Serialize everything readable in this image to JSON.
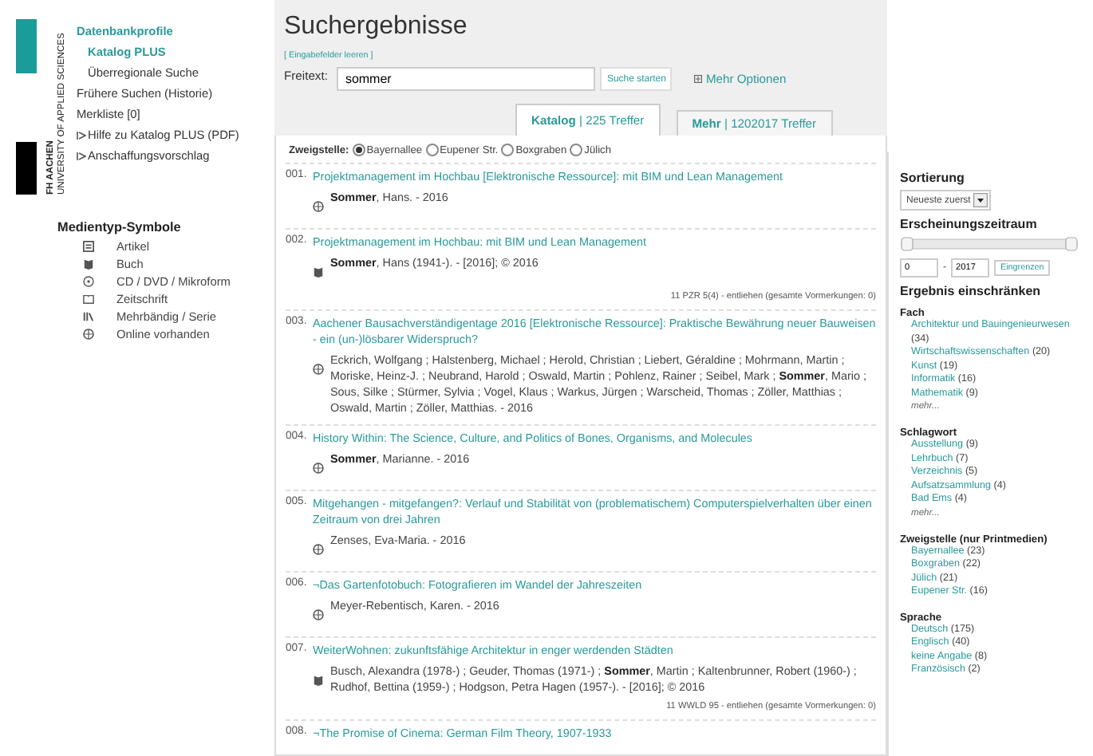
{
  "logo": {
    "line_1": "FH AACHEN",
    "line_2": "UNIVERSITY OF APPLIED SCIENCES"
  },
  "nav": [
    {
      "label": "Datenbankprofile",
      "kind": "heading"
    },
    {
      "label": "Katalog PLUS",
      "kind": "sub",
      "selected": true
    },
    {
      "label": "Überregionale Suche",
      "kind": "sub",
      "selected": false
    },
    {
      "label": "Frühere Suchen (Historie)",
      "kind": "link"
    },
    {
      "label": "Merkliste [0]",
      "kind": "link"
    },
    {
      "label": "Hilfe zu Katalog PLUS (PDF)",
      "kind": "external"
    },
    {
      "label": "Anschaffungsvorschlag",
      "kind": "external"
    }
  ],
  "media_legend": {
    "title": "Medientyp-Symbole",
    "items": [
      {
        "kind": "article",
        "label": "Artikel"
      },
      {
        "kind": "book",
        "label": "Buch"
      },
      {
        "kind": "disc",
        "label": "CD / DVD / Mikroform"
      },
      {
        "kind": "journal",
        "label": "Zeitschrift"
      },
      {
        "kind": "series",
        "label": "Mehrbändig / Serie"
      },
      {
        "kind": "online",
        "label": "Online vorhanden"
      }
    ]
  },
  "page_title": "Suchergebnisse",
  "clear_link": "[ Eingabefelder leeren ]",
  "search": {
    "label": "Freitext:",
    "value": "sommer",
    "button": "Suche starten",
    "more": "Mehr Optionen"
  },
  "tabs": [
    {
      "label": "Katalog",
      "separator": "|",
      "count": "225 Treffer",
      "selected": true
    },
    {
      "label": "Mehr",
      "separator": "|",
      "count": "1202017 Treffer",
      "selected": false
    }
  ],
  "branch_filter": {
    "label": "Zweigstelle:",
    "options": [
      {
        "label": "Bayernallee",
        "selected": true
      },
      {
        "label": "Eupener Str.",
        "selected": false
      },
      {
        "label": "Boxgraben",
        "selected": false
      },
      {
        "label": "Jülich",
        "selected": false
      }
    ]
  },
  "results": [
    {
      "number": "001.",
      "title": "Projektmanagement im Hochbau [Elektronische Ressource]: mit BIM und Lean Management",
      "kind": "online",
      "authors": "**Sommer**, Hans. - 2016"
    },
    {
      "number": "002.",
      "title": "Projektmanagement im Hochbau: mit BIM und Lean Management",
      "kind": "book",
      "authors": "**Sommer**, Hans (1941-). - [2016]; © 2016",
      "availability": "11 PZR 5(4) - entliehen (gesamte Vormerkungen: 0)"
    },
    {
      "number": "003.",
      "title": "Aachener Bausachverständigentage 2016 [Elektronische Ressource]: Praktische Bewährung neuer Bauweisen - ein (un-)lösbarer Widerspruch?",
      "kind": "online",
      "authors": "Eckrich, Wolfgang ; Halstenberg, Michael ; Herold, Christian ; Liebert, Géraldine ; Mohrmann, Martin ; Moriske, Heinz-J. ; Neubrand, Harold ; Oswald, Martin ; Pohlenz, Rainer ; Seibel, Mark ; **Sommer**, Mario ; Sous, Silke ; Stürmer, Sylvia ; Vogel, Klaus ; Warkus, Jürgen ; Warscheid, Thomas ; Zöller, Matthias ; Oswald, Martin ; Zöller, Matthias. - 2016"
    },
    {
      "number": "004.",
      "title": "History Within: The Science, Culture, and Politics of Bones, Organisms, and Molecules",
      "kind": "online",
      "authors": "**Sommer**, Marianne. - 2016"
    },
    {
      "number": "005.",
      "title": "Mitgehangen - mitgefangen?: Verlauf und Stabilität von (problematischem) Computerspielverhalten über einen Zeitraum von drei Jahren",
      "kind": "online",
      "authors": "Zenses, Eva-Maria. - 2016"
    },
    {
      "number": "006.",
      "title": "¬Das Gartenfotobuch: Fotografieren im Wandel der Jahreszeiten",
      "kind": "online",
      "authors": "Meyer-Rebentisch, Karen. - 2016"
    },
    {
      "number": "007.",
      "title": "WeiterWohnen: zukunftsfähige Architektur in enger werdenden Städten",
      "kind": "book",
      "authors": "Busch, Alexandra (1978-) ; Geuder, Thomas (1971-) ; **Sommer**, Martin ; Kaltenbrunner, Robert (1960-) ; Rudhof, Bettina (1959-) ; Hodgson, Petra Hagen (1957-). - [2016]; © 2016",
      "availability": "11 WWLD 95 - entliehen (gesamte Vormerkungen: 0)"
    },
    {
      "number": "008.",
      "title": "¬The Promise of Cinema: German Film Theory, 1907-1933"
    }
  ],
  "sorting": {
    "title": "Sortierung",
    "value": "Neueste zuerst"
  },
  "period": {
    "title": "Erscheinungszeitraum",
    "slider": {
      "low": {
        "level": 0
      },
      "high": {
        "level": 1
      }
    },
    "from": "0",
    "to": "2017",
    "separator": "-",
    "button": "Eingrenzen"
  },
  "refine": {
    "title": "Ergebnis einschränken",
    "groups": [
      {
        "title": "Fach",
        "items": [
          {
            "label": "Architektur und Bauingenieurwesen",
            "count": "(34)"
          },
          {
            "label": "Wirtschaftswissenschaften",
            "count": "(20)"
          },
          {
            "label": "Kunst",
            "count": "(19)"
          },
          {
            "label": "Informatik",
            "count": "(16)"
          },
          {
            "label": "Mathematik",
            "count": "(9)"
          }
        ],
        "more": "mehr..."
      },
      {
        "title": "Schlagwort",
        "items": [
          {
            "label": "Ausstellung",
            "count": "(9)"
          },
          {
            "label": "Lehrbuch",
            "count": "(7)"
          },
          {
            "label": "Verzeichnis",
            "count": "(5)"
          },
          {
            "label": "Aufsatzsammlung",
            "count": "(4)"
          },
          {
            "label": "Bad Ems",
            "count": "(4)"
          }
        ],
        "more": "mehr..."
      },
      {
        "title": "Zweigstelle (nur Printmedien)",
        "items": [
          {
            "label": "Bayernallee",
            "count": "(23)"
          },
          {
            "label": "Boxgraben",
            "count": "(22)"
          },
          {
            "label": "Jülich",
            "count": "(21)"
          },
          {
            "label": "Eupener Str.",
            "count": "(16)"
          }
        ]
      },
      {
        "title": "Sprache",
        "items": [
          {
            "label": "Deutsch",
            "count": "(175)"
          },
          {
            "label": "Englisch",
            "count": "(40)"
          },
          {
            "label": "keine Angabe",
            "count": "(8)"
          },
          {
            "label": "Französisch",
            "count": "(2)"
          }
        ]
      }
    ]
  }
}
